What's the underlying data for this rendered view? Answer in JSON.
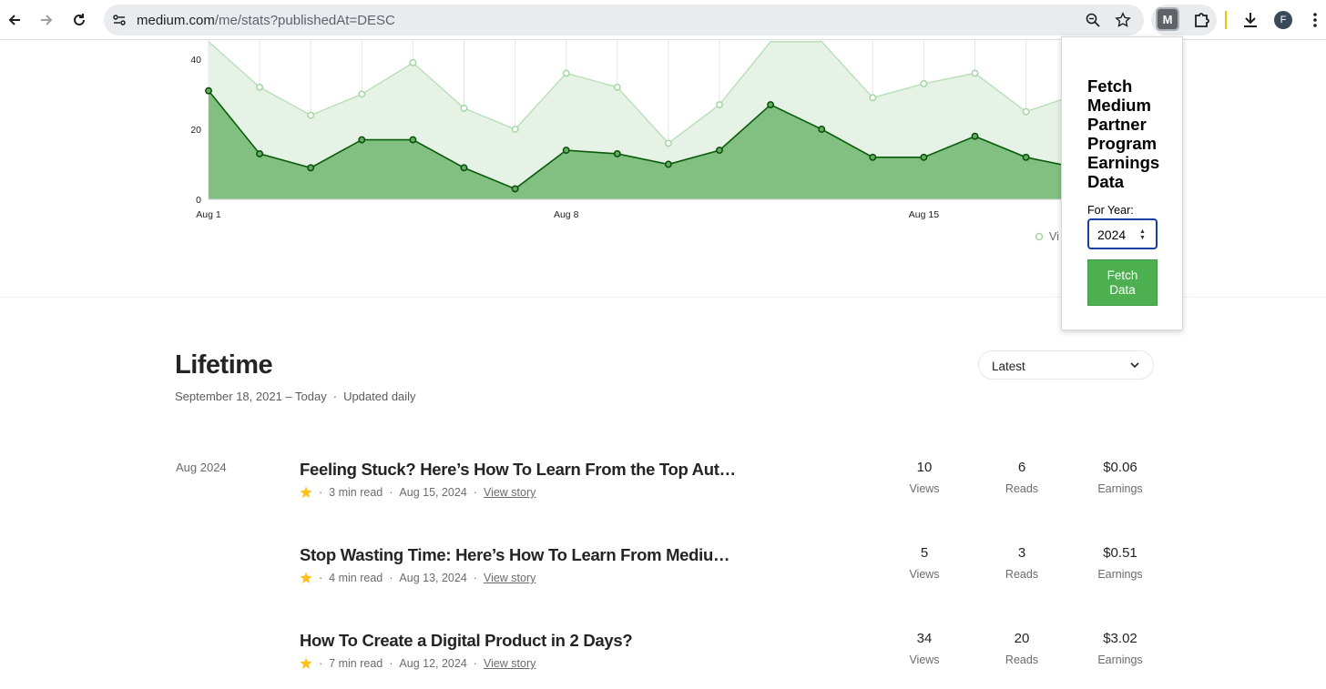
{
  "browser": {
    "url_host": "medium.com",
    "url_path": "/me/stats?publishedAt=DESC",
    "avatar_letter": "F",
    "extension_letter": "M"
  },
  "chart_data": {
    "type": "area",
    "y_ticks": [
      "40",
      "20",
      "0"
    ],
    "ylim": [
      0,
      45
    ],
    "x_ticks": [
      {
        "label": "Aug 1",
        "day": 1
      },
      {
        "label": "Aug 8",
        "day": 8
      },
      {
        "label": "Aug 15",
        "day": 15
      }
    ],
    "legend_text": "Vi",
    "series": [
      {
        "days": [
          1,
          2,
          3,
          4,
          5,
          6,
          7,
          8,
          9,
          10,
          11,
          12,
          13,
          14,
          15,
          16,
          17,
          18
        ],
        "values": [
          45,
          32,
          24,
          30,
          39,
          26,
          20,
          36,
          32,
          16,
          27,
          45,
          45,
          29,
          33,
          36,
          25,
          30
        ],
        "color": "#b9dfb9",
        "fill": "#e5f2e5"
      },
      {
        "days": [
          1,
          2,
          3,
          4,
          5,
          6,
          7,
          8,
          9,
          10,
          11,
          12,
          13,
          14,
          15,
          16,
          17,
          18
        ],
        "values": [
          31,
          13,
          9,
          17,
          17,
          9,
          3,
          14,
          13,
          10,
          14,
          27,
          20,
          12,
          12,
          18,
          12,
          9
        ],
        "color": "#0a5c0a",
        "fill": "#82c082"
      }
    ]
  },
  "popup": {
    "title": "Fetch Medium Partner Program Earnings Data",
    "year_label": "For Year:",
    "year_value": "2024",
    "button_label": "Fetch Data"
  },
  "lifetime": {
    "title": "Lifetime",
    "range": "September 18, 2021 – Today",
    "dot": "·",
    "updated": "Updated daily",
    "sort_value": "Latest",
    "month_label": "Aug 2024"
  },
  "stories": [
    {
      "title": "Feeling Stuck? Here’s How To Learn From the Top Aut…",
      "read_time": "3 min read",
      "date": "Aug 15, 2024",
      "link": "View story",
      "views": "10",
      "views_label": "Views",
      "reads": "6",
      "reads_label": "Reads",
      "earnings": "$0.06",
      "earnings_label": "Earnings"
    },
    {
      "title": "Stop Wasting Time: Here’s How To Learn From Mediu…",
      "read_time": "4 min read",
      "date": "Aug 13, 2024",
      "link": "View story",
      "views": "5",
      "views_label": "Views",
      "reads": "3",
      "reads_label": "Reads",
      "earnings": "$0.51",
      "earnings_label": "Earnings"
    },
    {
      "title": "How To Create a Digital Product in 2 Days?",
      "read_time": "7 min read",
      "date": "Aug 12, 2024",
      "link": "View story",
      "views": "34",
      "views_label": "Views",
      "reads": "20",
      "reads_label": "Reads",
      "earnings": "$3.02",
      "earnings_label": "Earnings"
    }
  ],
  "meta_dot": "·"
}
